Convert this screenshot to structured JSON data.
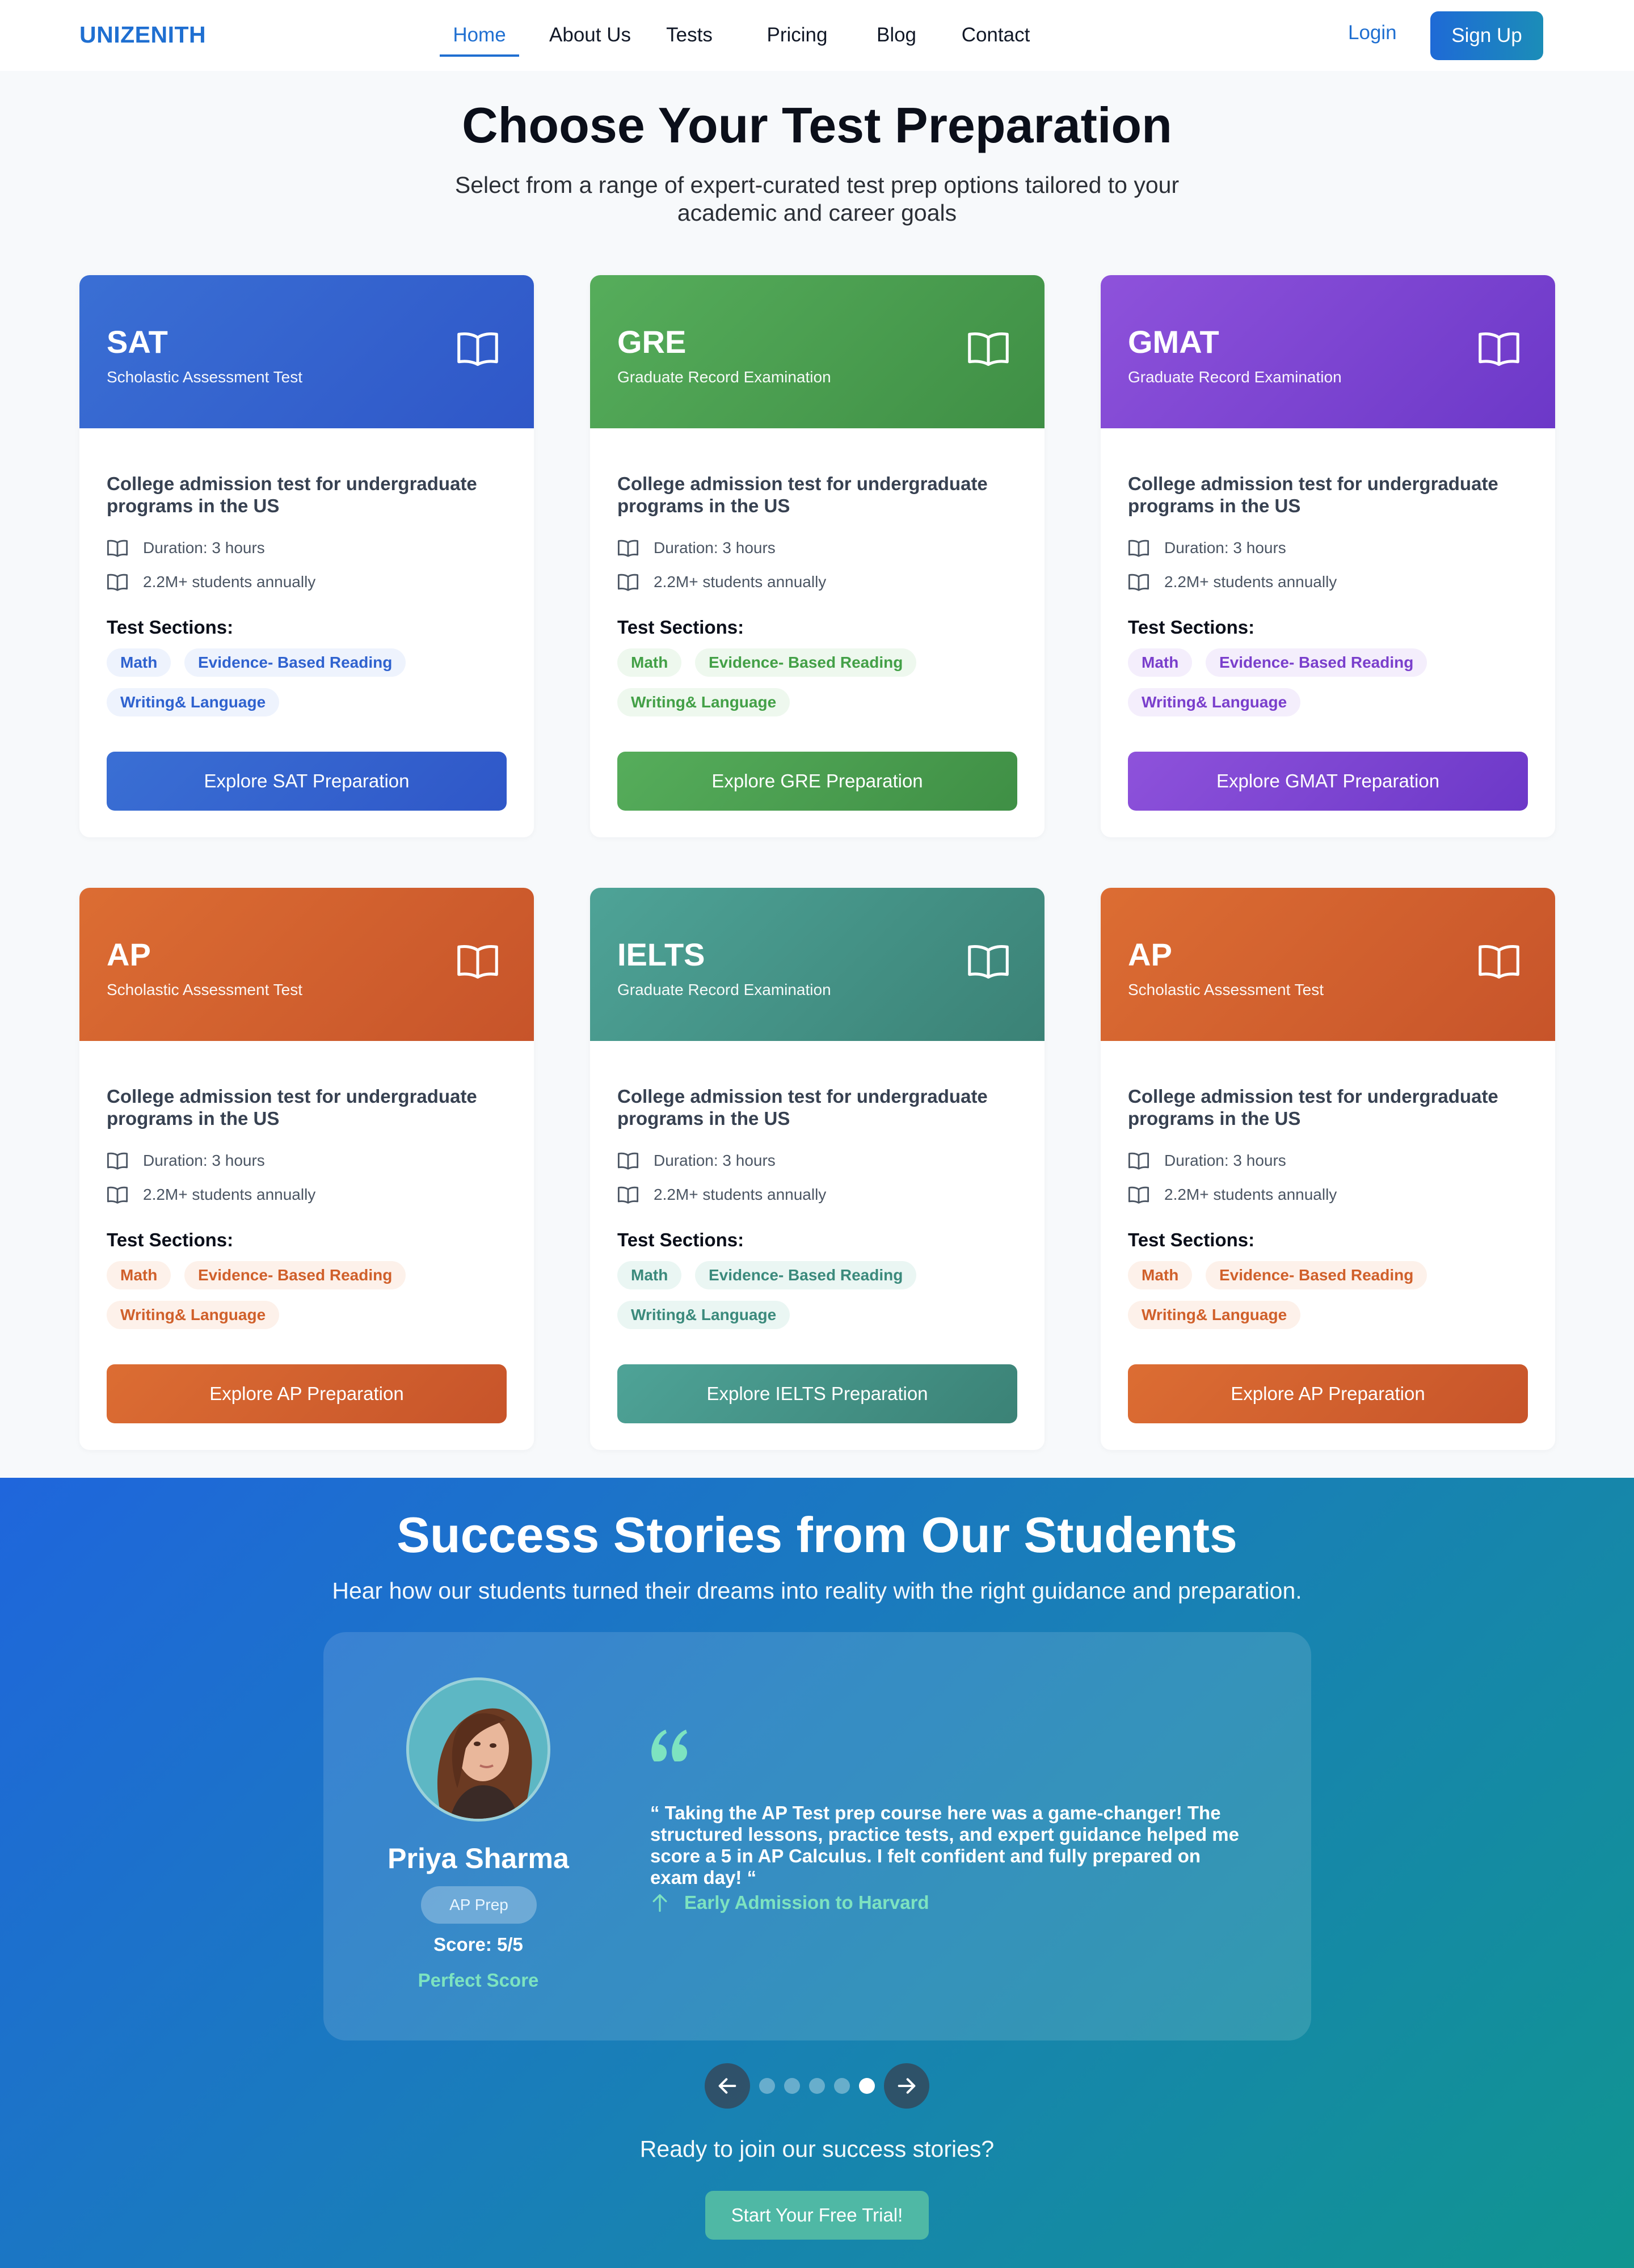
{
  "nav": {
    "logo": "UNIZENITH",
    "links": [
      "Home",
      "About Us",
      "Tests",
      "Pricing",
      "Blog",
      "Contact"
    ],
    "active": "Home",
    "login": "Login",
    "signup": "Sign Up"
  },
  "hero": {
    "title": "Choose Your Test Preparation",
    "subtitle": "Select from a range of expert-curated test prep options tailored to your academic and career goals"
  },
  "cards": [
    {
      "name": "SAT",
      "full": "Scholastic Assessment Test",
      "desc": "College admission test for undergraduate programs in the US",
      "duration": "Duration: 3 hours",
      "students": "2.2M+ students annually",
      "sections_label": "Test Sections:",
      "sections": [
        "Math",
        "Evidence- Based Reading",
        "Writing& Language"
      ],
      "button": "Explore SAT Preparation",
      "colors": {
        "from": "#3a6fd4",
        "to": "#2f57c8",
        "chip_bg": "#eef3fd",
        "chip_fg": "#2f62cf"
      }
    },
    {
      "name": "GRE",
      "full": "Graduate Record Examination",
      "desc": "College admission test for undergraduate programs in the US",
      "duration": "Duration: 3 hours",
      "students": "2.2M+ students annually",
      "sections_label": "Test Sections:",
      "sections": [
        "Math",
        "Evidence- Based Reading",
        "Writing& Language"
      ],
      "button": "Explore GRE Preparation",
      "colors": {
        "from": "#56ad5b",
        "to": "#3f8f45",
        "chip_bg": "#eef8ee",
        "chip_fg": "#43a047"
      }
    },
    {
      "name": "GMAT",
      "full": "Graduate Record Examination",
      "desc": "College admission test for undergraduate programs in the US",
      "duration": "Duration: 3 hours",
      "students": "2.2M+ students annually",
      "sections_label": "Test Sections:",
      "sections": [
        "Math",
        "Evidence- Based Reading",
        "Writing& Language"
      ],
      "button": "Explore GMAT Preparation",
      "colors": {
        "from": "#8e52db",
        "to": "#6c38c8",
        "chip_bg": "#f4eefc",
        "chip_fg": "#7a3fcc"
      }
    },
    {
      "name": "AP",
      "full": "Scholastic Assessment Test",
      "desc": "College admission test for undergraduate programs in the US",
      "duration": "Duration: 3 hours",
      "students": "2.2M+ students annually",
      "sections_label": "Test Sections:",
      "sections": [
        "Math",
        "Evidence- Based Reading",
        "Writing& Language"
      ],
      "button": "Explore AP Preparation",
      "colors": {
        "from": "#dc6d33",
        "to": "#c7542a",
        "chip_bg": "#fdf1ea",
        "chip_fg": "#d0602b"
      }
    },
    {
      "name": "IELTS",
      "full": "Graduate Record Examination",
      "desc": "College admission test for undergraduate programs in the US",
      "duration": "Duration: 3 hours",
      "students": "2.2M+ students annually",
      "sections_label": "Test Sections:",
      "sections": [
        "Math",
        "Evidence- Based Reading",
        "Writing& Language"
      ],
      "button": "Explore IELTS Preparation",
      "colors": {
        "from": "#4ea397",
        "to": "#3b8276",
        "chip_bg": "#eaf6f3",
        "chip_fg": "#3b8a7c"
      }
    },
    {
      "name": "AP",
      "full": "Scholastic Assessment Test",
      "desc": "College admission test for undergraduate programs in the US",
      "duration": "Duration: 3 hours",
      "students": "2.2M+ students annually",
      "sections_label": "Test Sections:",
      "sections": [
        "Math",
        "Evidence- Based Reading",
        "Writing& Language"
      ],
      "button": "Explore AP Preparation",
      "colors": {
        "from": "#dc6d33",
        "to": "#c7542a",
        "chip_bg": "#fdf1ea",
        "chip_fg": "#d0602b"
      }
    }
  ],
  "success": {
    "title": "Success Stories from Our Students",
    "subtitle": "Hear how our students turned their dreams into reality with the right guidance and preparation.",
    "testimonial": {
      "name": "Priya Sharma",
      "badge": "AP Prep",
      "score": "Score: 5/5",
      "score_note": "Perfect Score",
      "quote": "“ Taking the AP Test prep course here was a game-changer! The structured lessons, practice tests, and expert guidance helped me score a 5 in AP Calculus. I felt confident and fully prepared on exam day! “",
      "achievement": "Early Admission to Harvard"
    },
    "carousel": {
      "total": 5,
      "active_index": 4
    },
    "ready": "Ready to join our success stories?",
    "cta": "Start Your Free Trial!"
  }
}
